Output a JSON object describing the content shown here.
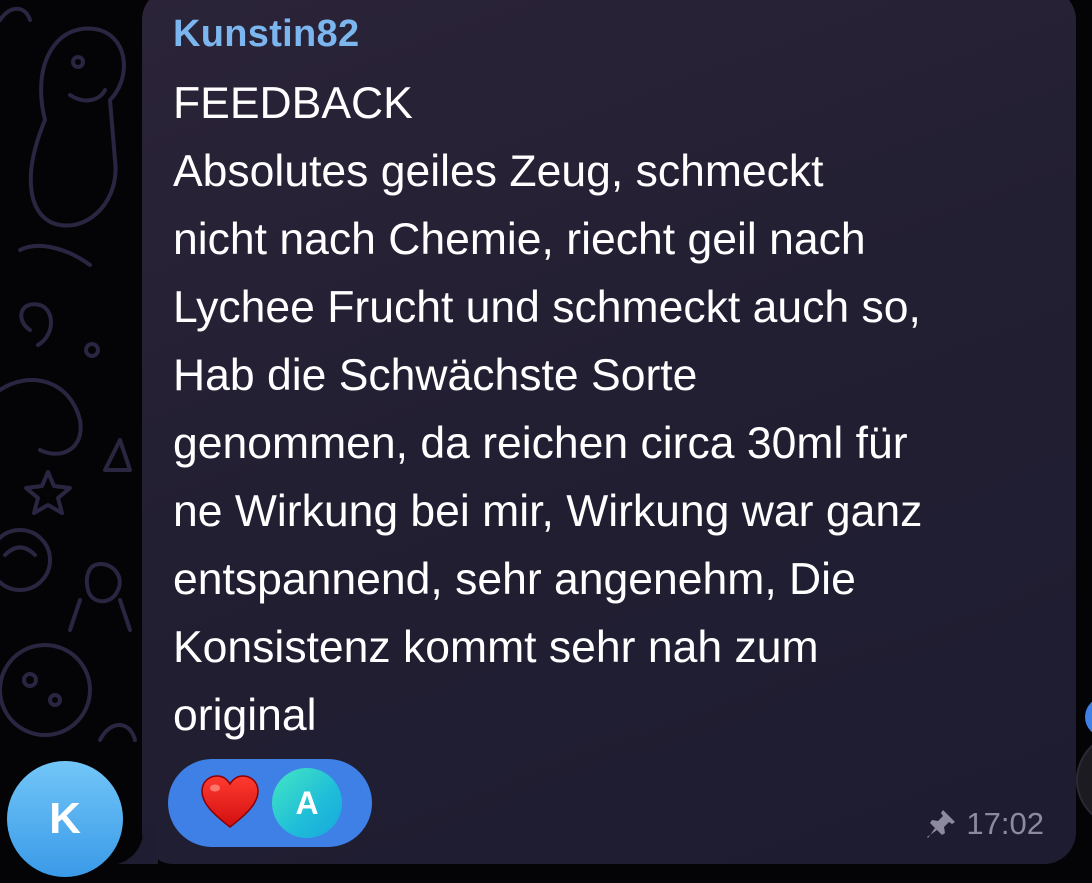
{
  "message": {
    "sender": "Kunstin82",
    "lines": [
      "FEEDBACK",
      "Absolutes geiles Zeug, schmeckt",
      "nicht nach Chemie, riecht geil nach",
      "Lychee Frucht und schmeckt auch so,",
      "Hab die Schwächste Sorte",
      "genommen, da reichen circa 30ml für",
      "ne Wirkung bei mir, Wirkung war ganz",
      "entspannend, sehr angenehm, Die",
      "Konsistenz kommt sehr nah zum",
      "original"
    ],
    "time": "17:02",
    "pinned": true
  },
  "reactions": {
    "emoji_icon": "red-heart-icon",
    "reactor_initial": "A"
  },
  "sender_avatar": {
    "initial": "K"
  },
  "colors": {
    "sender_name": "#7cb6ef",
    "bubble": "#2b2438",
    "reaction_pill": "#3e80e6",
    "timestamp": "#8d8a9e",
    "avatar": "#5bb4f2"
  }
}
